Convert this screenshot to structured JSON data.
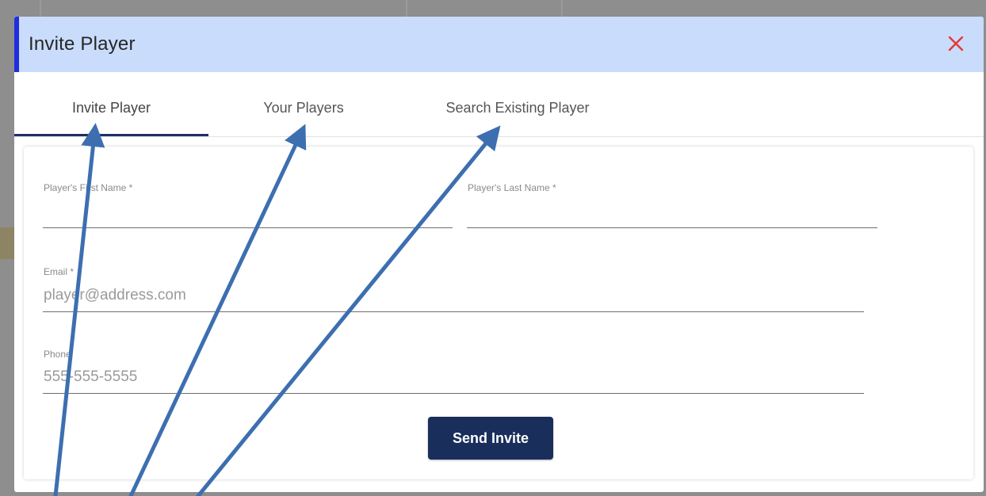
{
  "modal": {
    "title": "Invite Player",
    "close_symbol": "✕",
    "colors": {
      "header_bg": "#c9dcfb",
      "accent_bar": "#1f2ee0",
      "close": "#e53935",
      "tab_underline": "#1e2f66",
      "button_bg": "#1a2e5c"
    }
  },
  "tabs": [
    {
      "label": "Invite Player",
      "active": true
    },
    {
      "label": "Your Players",
      "active": false
    },
    {
      "label": "Search Existing Player",
      "active": false
    }
  ],
  "form": {
    "first_name": {
      "label": "Player's First Name *",
      "value": ""
    },
    "last_name": {
      "label": "Player's Last Name *",
      "value": ""
    },
    "email": {
      "label": "Email *",
      "placeholder": "player@address.com"
    },
    "phone": {
      "label": "Phone",
      "placeholder": "555-555-5555"
    },
    "submit_label": "Send Invite"
  },
  "annotations": {
    "arrow_color": "#3d6fb0",
    "arrow_count": 3
  }
}
